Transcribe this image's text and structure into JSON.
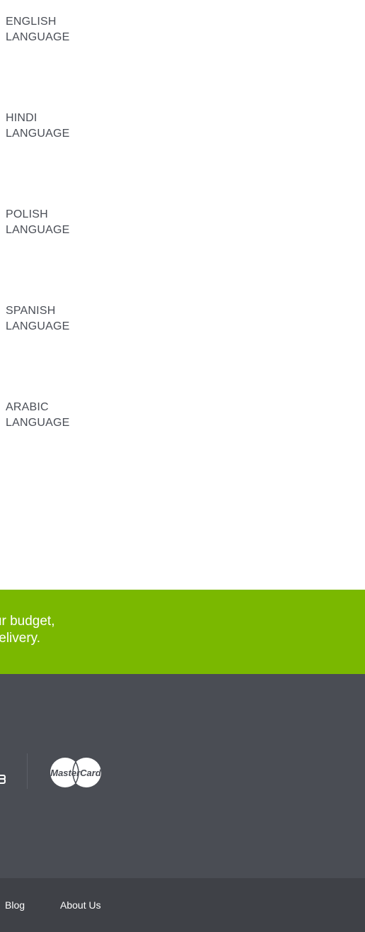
{
  "languages": [
    {
      "line1": "ENGLISH",
      "line2": "LANGUAGE"
    },
    {
      "line1": "HINDI",
      "line2": "LANGUAGE"
    },
    {
      "line1": "POLISH",
      "line2": "LANGUAGE"
    },
    {
      "line1": "SPANISH",
      "line2": "LANGUAGE"
    },
    {
      "line1": "ARABIC",
      "line2": "LANGUAGE"
    }
  ],
  "banner": {
    "line1": "n your budget,",
    "line2": "ent delivery."
  },
  "payments": {
    "logos": [
      "partial-payment-logo",
      "mastercard-logo"
    ],
    "mastercard_text": "MasterCard"
  },
  "footer": {
    "links": [
      "Blog",
      "About Us"
    ]
  },
  "colors": {
    "banner": "#7ab800",
    "payments_bg": "#4a4d54",
    "footer_bg": "#3f4147",
    "text_dark": "#4a4e56"
  }
}
